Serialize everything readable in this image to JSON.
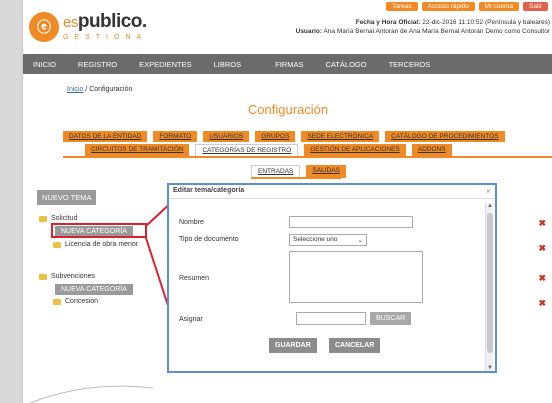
{
  "toplinks": [
    "Tareas",
    "Acceso rápido",
    "Mi cuenta",
    "Salir"
  ],
  "logo": {
    "es": "es",
    "main": "publico.",
    "sub": "GESTIONA"
  },
  "userinfo": {
    "line1_label": "Fecha y Hora Oficial:",
    "line1_value": "22-dic-2016 11:10:52 (Península y baleares)",
    "line2_label": "Usuario:",
    "line2_value": "Ana María Bernal Antoran de Ana María Bernal Antoran Demo como Consultor"
  },
  "nav": [
    "INICIO",
    "REGISTRO",
    "EXPEDIENTES",
    "LIBROS",
    "FIRMAS",
    "CATÁLOGO",
    "TERCEROS"
  ],
  "breadcrumb": {
    "home": "Inicio",
    "sep": " / ",
    "current": "Configuración"
  },
  "page_title": "Configuración",
  "tabs_row1": [
    "DATOS DE LA ENTIDAD",
    "FORMATO",
    "USUARIOS",
    "GRUPOS",
    "SEDE ELECTRÓNICA",
    "CATÁLOGO DE PROCEDIMIENTOS"
  ],
  "tabs_row2": [
    "CIRCUITOS DE TRAMITACIÓN",
    "CATEGORÍAS DE REGISTRO",
    "GESTIÓN DE APLICACIONES",
    "ADDONS"
  ],
  "tabs_row3": [
    "ENTRADAS",
    "SALIDAS"
  ],
  "sidebar": {
    "new_theme": "NUEVO TEMA",
    "item1": "Solicitud",
    "new_category_1": "NUEVA CATEGORÍA",
    "item1_child": "Licencia de obra menor",
    "item2": "Subvenciones",
    "new_category_2": "NUEVA CATEGORÍA",
    "item2_child": "Concesión"
  },
  "modal": {
    "title": "Editar tema/categoría",
    "close": "×",
    "nombre_label": "Nombre",
    "tipo_label": "Tipo de documento",
    "tipo_value": "Seleccione uno",
    "resumen_label": "Resumen",
    "asignar_label": "Asignar",
    "search_button": "BUSCAR",
    "save_button": "GUARDAR",
    "cancel_button": "CANCELAR"
  },
  "colors": {
    "accent": "#f08a24",
    "nav": "#6b6b6b",
    "highlight": "#d9232d",
    "modal_border": "#5b8fd0"
  }
}
